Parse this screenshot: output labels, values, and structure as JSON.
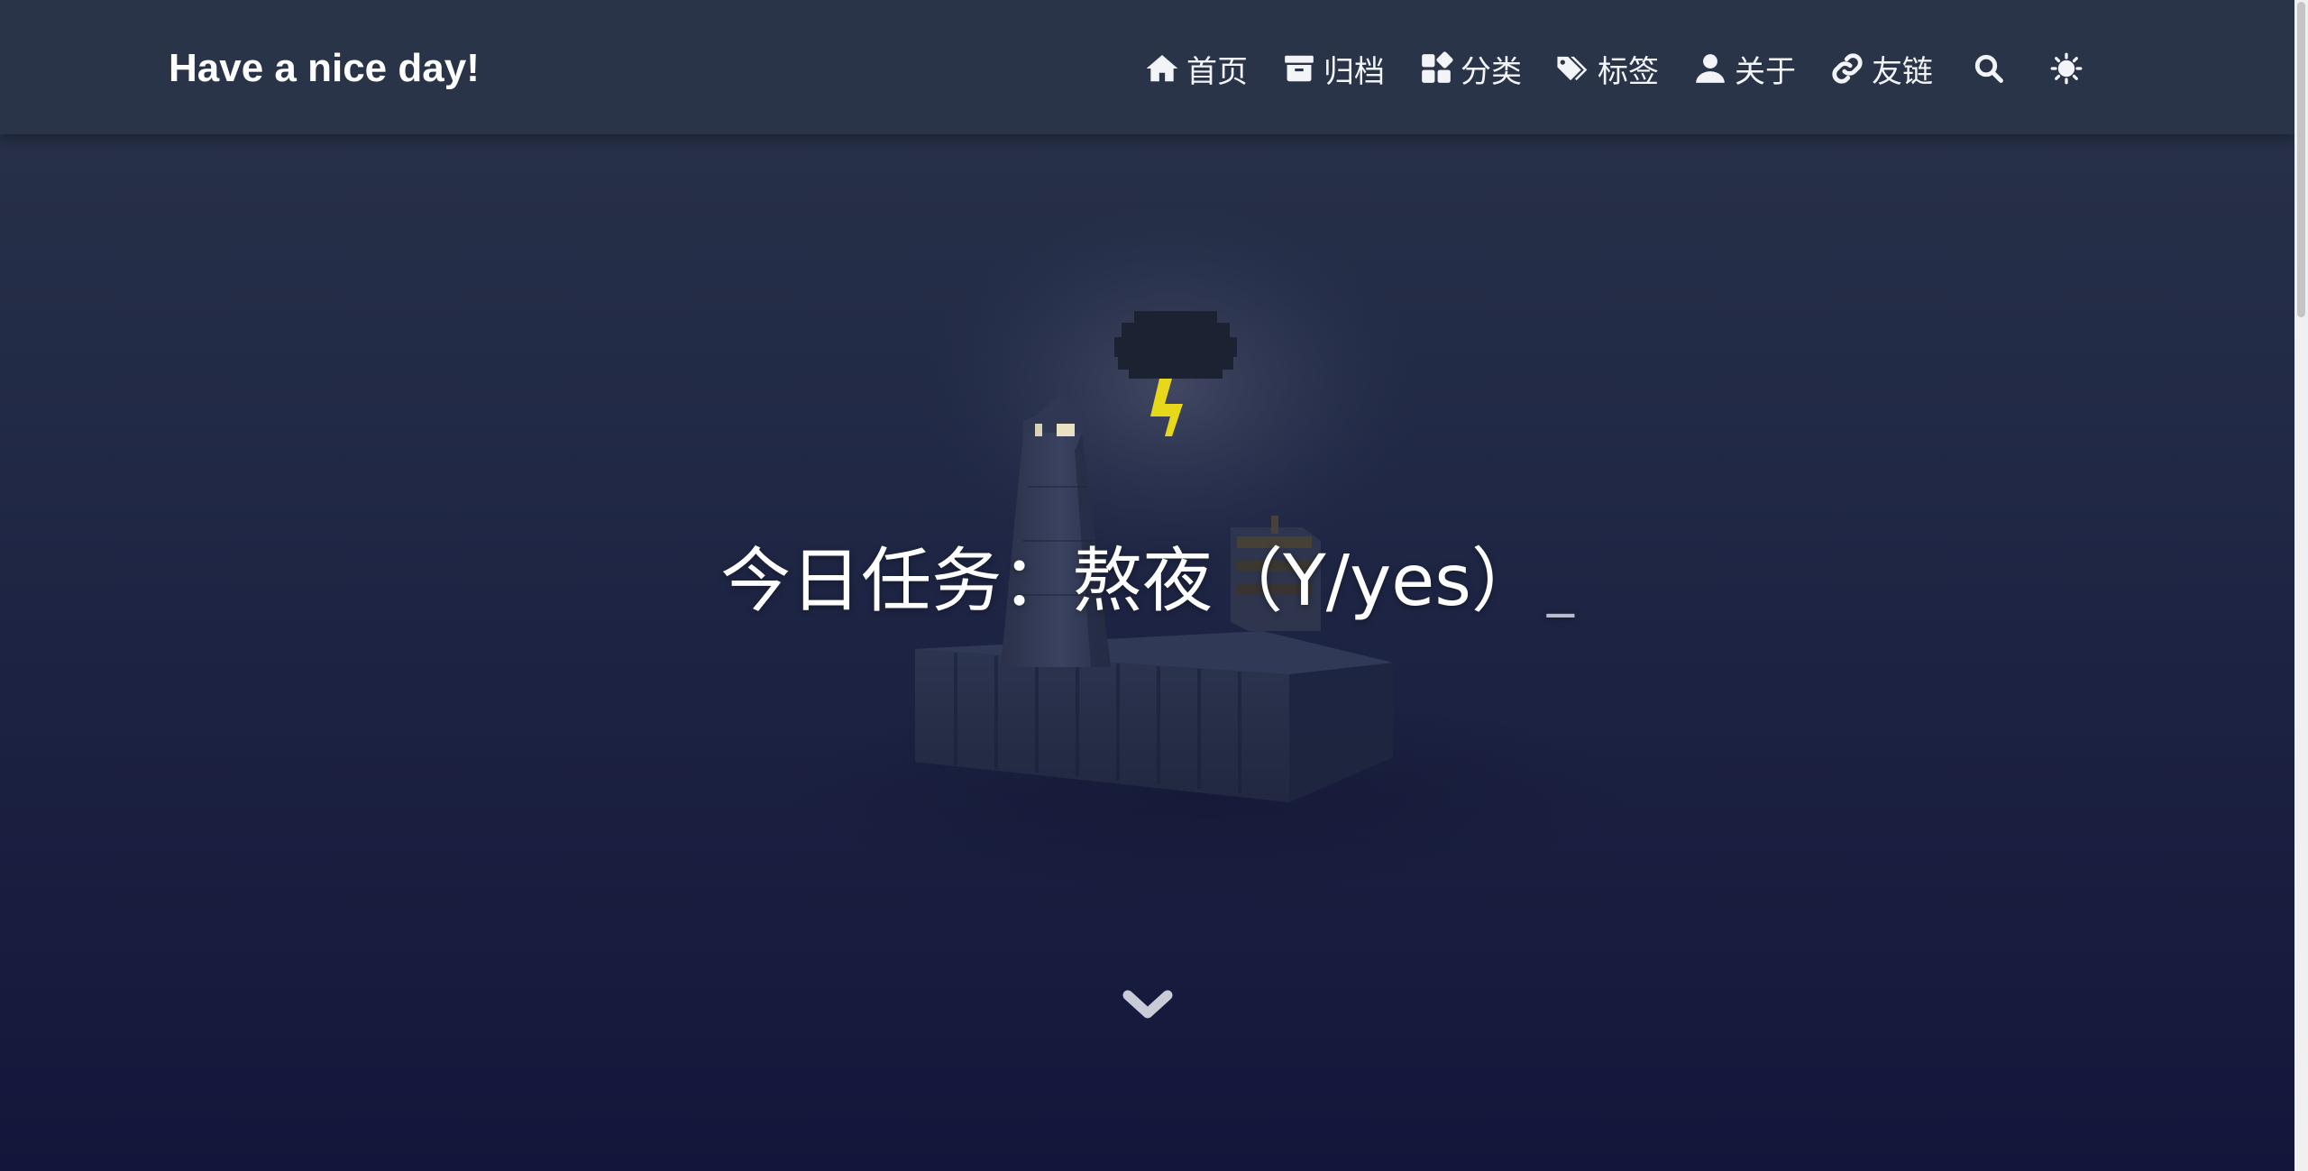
{
  "brand": {
    "title": "Have a nice day!"
  },
  "nav": {
    "items": [
      {
        "label": "首页",
        "icon": "home-icon"
      },
      {
        "label": "归档",
        "icon": "archive-icon"
      },
      {
        "label": "分类",
        "icon": "categories-icon"
      },
      {
        "label": "标签",
        "icon": "tags-icon"
      },
      {
        "label": "关于",
        "icon": "user-icon"
      },
      {
        "label": "友链",
        "icon": "link-icon"
      }
    ],
    "search_icon": "search-icon",
    "theme_icon": "sun-icon"
  },
  "hero": {
    "subtitle": "今日任务：熬夜（Y/yes）",
    "cursor": "_",
    "scroll_icon": "chevron-down-icon"
  },
  "colors": {
    "navbar": "#2a3449",
    "background_top": "#2a3349",
    "background_bottom": "#13163a",
    "lightning": "#e7d81a"
  }
}
